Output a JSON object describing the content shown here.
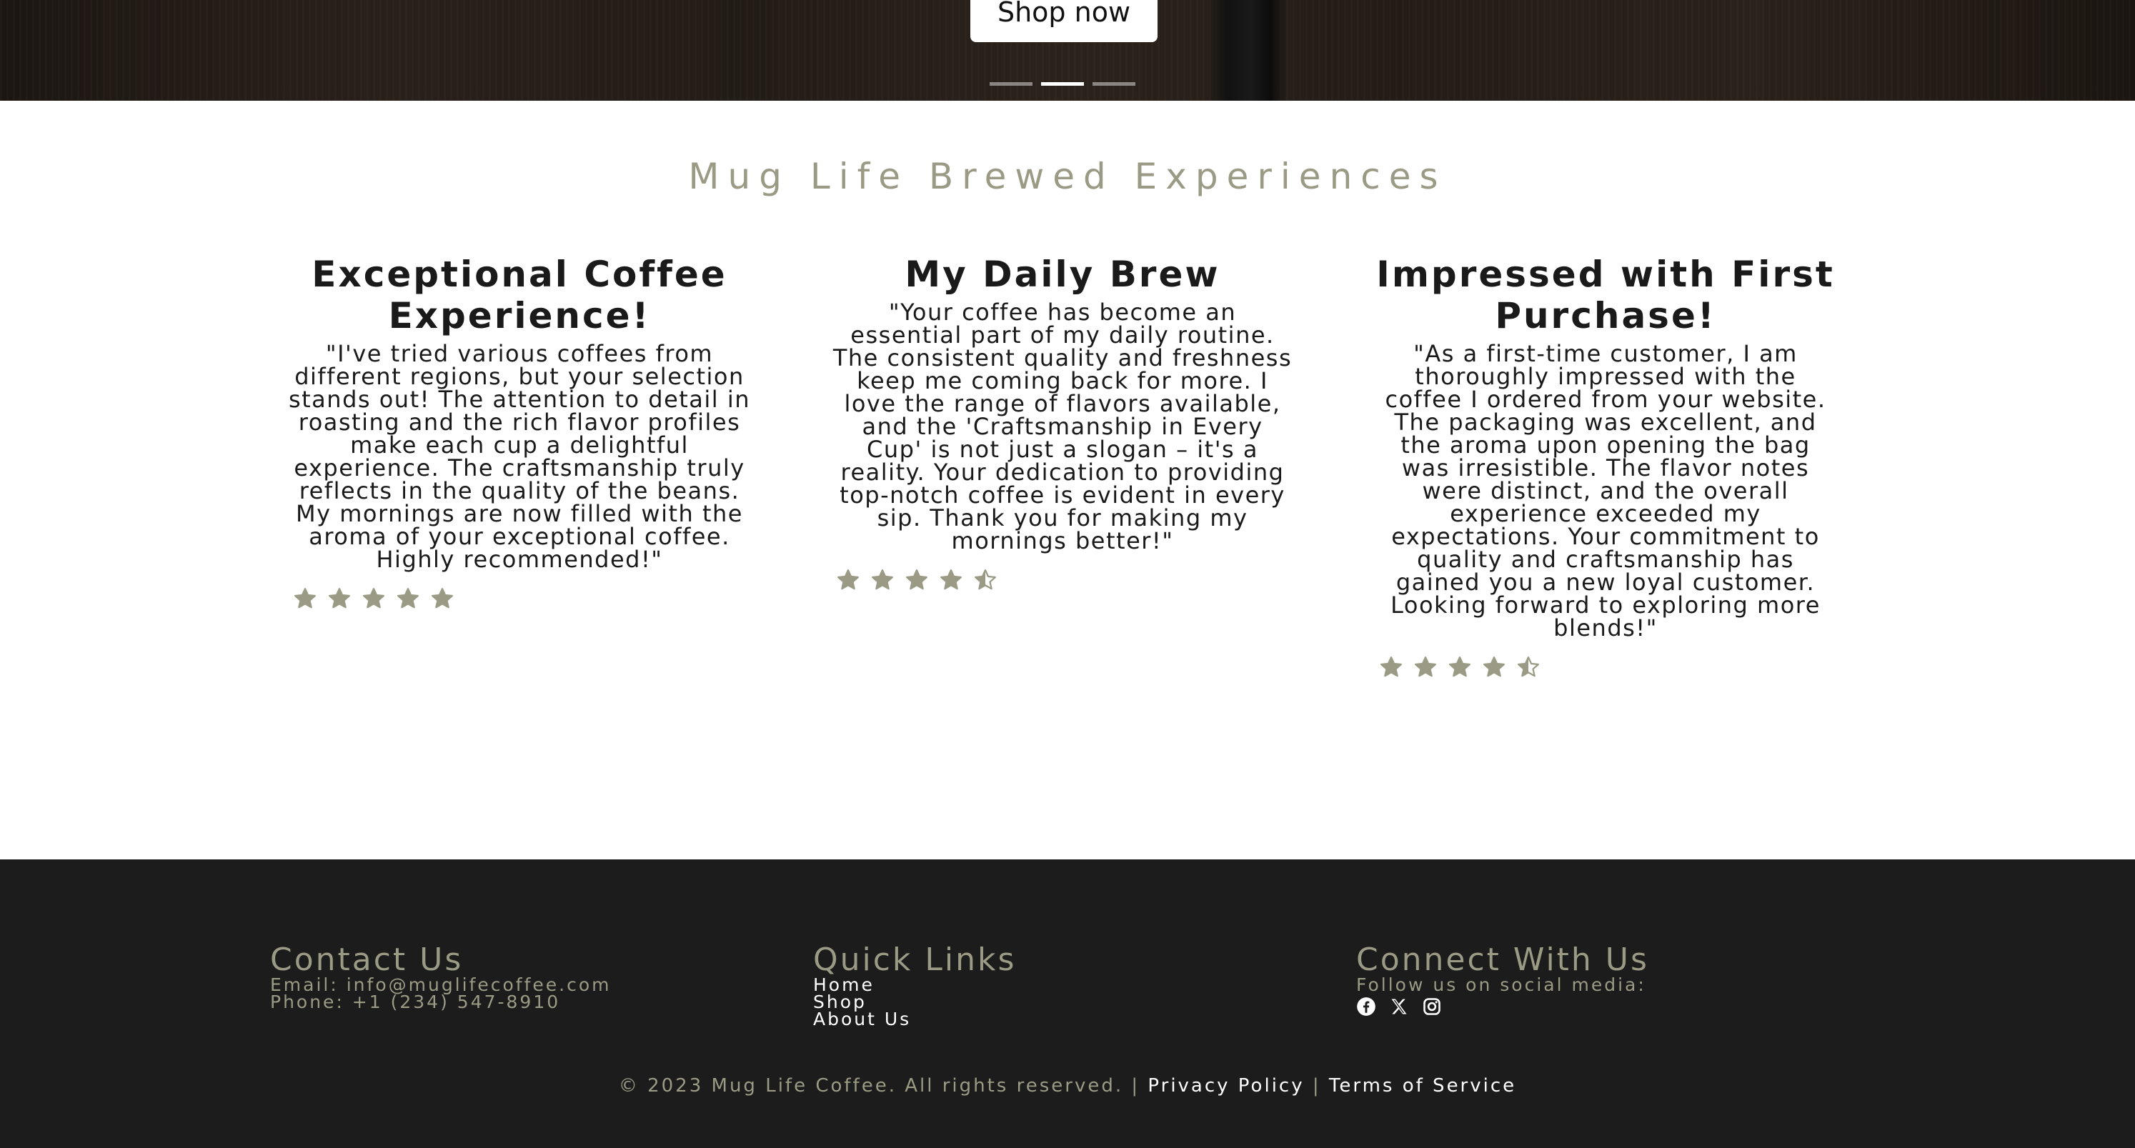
{
  "hero": {
    "button_label": "Shop now",
    "slides": [
      {
        "active": false
      },
      {
        "active": true
      },
      {
        "active": false
      }
    ]
  },
  "testimonials": {
    "title": "Mug Life Brewed Experiences",
    "items": [
      {
        "heading": "Exceptional Coffee Experience!",
        "quote": "\"I've tried various coffees from different regions, but your selection stands out! The attention to detail in roasting and the rich flavor profiles make each cup a delightful experience. The craftsmanship truly reflects in the quality of the beans. My mornings are now filled with the aroma of your exceptional coffee. Highly recommended!\"",
        "rating": 5
      },
      {
        "heading": "My Daily Brew",
        "quote": "\"Your coffee has become an essential part of my daily routine. The consistent quality and freshness keep me coming back for more. I love the range of flavors available, and the 'Craftsmanship in Every Cup' is not just a slogan – it's a reality. Your dedication to providing top-notch coffee is evident in every sip. Thank you for making my mornings better!\"",
        "rating": 4.5
      },
      {
        "heading": "Impressed with First Purchase!",
        "quote": "\"As a first-time customer, I am thoroughly impressed with the coffee I ordered from your website. The packaging was excellent, and the aroma upon opening the bag was irresistible. The flavor notes were distinct, and the overall experience exceeded my expectations. Your commitment to quality and craftsmanship has gained you a new loyal customer. Looking forward to exploring more blends!\"",
        "rating": 4.5
      }
    ]
  },
  "footer": {
    "contact": {
      "title": "Contact Us",
      "email": "Email: info@muglifecoffee.com",
      "phone": "Phone: +1 (234) 547-8910"
    },
    "quick_links": {
      "title": "Quick Links",
      "links": [
        "Home",
        "Shop",
        "About Us"
      ]
    },
    "connect": {
      "title": "Connect With Us",
      "subtitle": "Follow us on social media:",
      "icons": [
        "facebook-icon",
        "x-twitter-icon",
        "instagram-icon"
      ]
    },
    "copyright": "© 2023 Mug Life Coffee. All rights reserved. |",
    "privacy": "Privacy Policy",
    "separator": "|",
    "terms": "Terms of Service"
  },
  "colors": {
    "accent": "#9a9a85",
    "footer_bg": "#1c1c1c",
    "text_dark": "#1a1a1a"
  }
}
